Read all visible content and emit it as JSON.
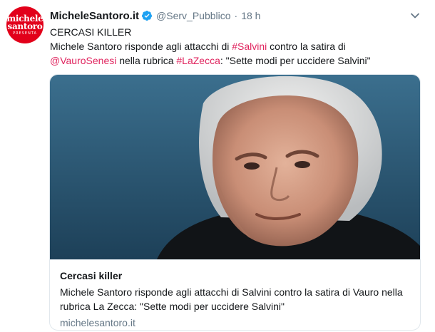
{
  "author": {
    "display_name": "MicheleSantoro.it",
    "handle": "@Serv_Pubblico",
    "separator": "·",
    "time": "18 h",
    "avatar_text": [
      "michele",
      "santoro",
      "PRESENTA"
    ]
  },
  "tweet": {
    "line1": "CERCASI KILLER",
    "line2_a": "Michele Santoro risponde agli attacchi di ",
    "hashtag_salvini": "#Salvini",
    "line2_b": " contro la satira di",
    "mention_vauro": "@VauroSenesi",
    "line3_a": " nella rubrica ",
    "hashtag_lazecca": "#LaZecca",
    "line3_b": ": \"Sette modi per uccidere Salvini\""
  },
  "card": {
    "title": "Cercasi killer",
    "description": "Michele Santoro risponde agli attacchi di Salvini contro la satira di Vauro nella rubrica La Zecca: \"Sette modi per uccidere Salvini\"",
    "url": "michelesantoro.it"
  },
  "icons": {
    "verified": "verified-badge-icon",
    "menu": "chevron-down-icon"
  },
  "colors": {
    "accent_link": "#e0245e",
    "verified_blue": "#1da1f2",
    "muted": "#657786",
    "avatar_red": "#e2001a"
  }
}
